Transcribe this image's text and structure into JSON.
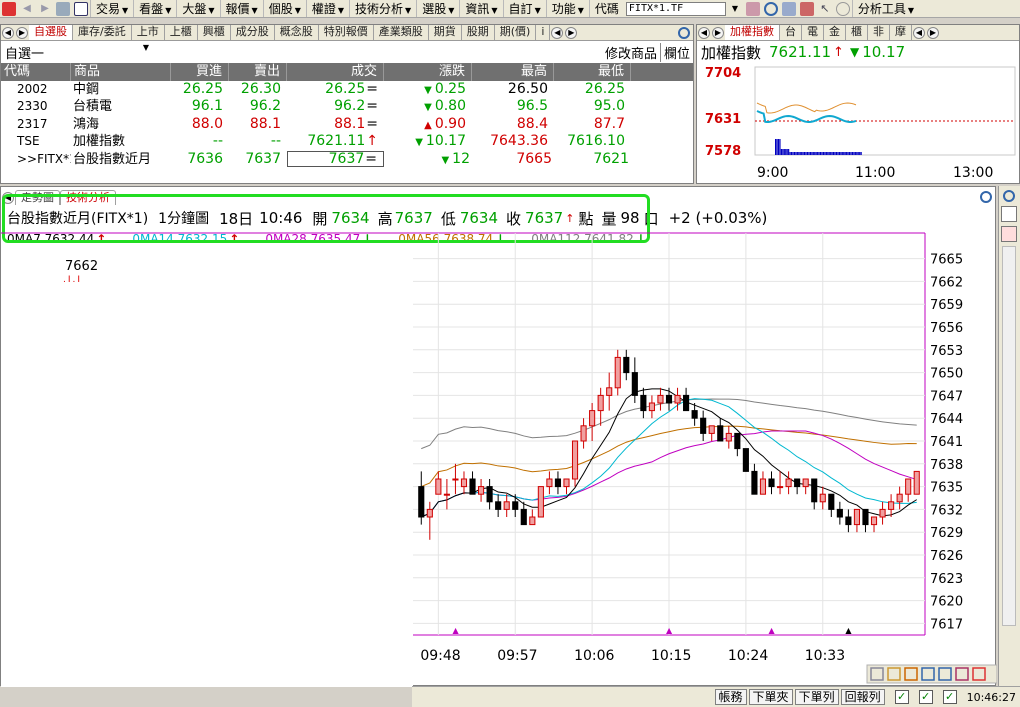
{
  "menubar": {
    "items": [
      "交易",
      "看盤",
      "大盤",
      "報價",
      "個股",
      "權證",
      "技術分析",
      "選股",
      "資訊",
      "自訂",
      "功能"
    ],
    "code_label": "代碼",
    "code_value": "FITX*1.TF",
    "tools_label": "分析工具"
  },
  "watchlist": {
    "tabs": [
      "自選股",
      "庫存/委託",
      "上市",
      "上櫃",
      "興櫃",
      "成分股",
      "概念股",
      "特別報價",
      "產業類股",
      "期貨",
      "股期",
      "期(價)",
      "i"
    ],
    "group": "自選一",
    "modify_label": "修改商品",
    "columns_label": "欄位",
    "headers": [
      "代碼",
      "商品",
      "買進",
      "賣出",
      "成交",
      "漲跌",
      "最高",
      "最低"
    ],
    "rows": [
      {
        "code": "2002",
        "name": "中鋼",
        "bid": "26.25",
        "ask": "26.30",
        "last": "26.25",
        "last_mark": "=",
        "chg_dir": "dn",
        "chg": "0.25",
        "high": "26.50",
        "low": "26.25",
        "color": "g",
        "high_color": "k",
        "low_color": "g"
      },
      {
        "code": "2330",
        "name": "台積電",
        "bid": "96.1",
        "ask": "96.2",
        "last": "96.2",
        "last_mark": "=",
        "chg_dir": "dn",
        "chg": "0.80",
        "high": "96.5",
        "low": "95.0",
        "color": "g",
        "high_color": "g",
        "low_color": "g"
      },
      {
        "code": "2317",
        "name": "鴻海",
        "bid": "88.0",
        "ask": "88.1",
        "last": "88.1",
        "last_mark": "=",
        "chg_dir": "up",
        "chg": "0.90",
        "high": "88.4",
        "low": "87.7",
        "color": "r",
        "high_color": "r",
        "low_color": "r"
      },
      {
        "code": "TSE",
        "name": "加權指數",
        "bid": "--",
        "ask": "--",
        "last": "7621.11",
        "last_mark": "↑",
        "chg_dir": "dn",
        "chg": "10.17",
        "high": "7643.36",
        "low": "7616.10",
        "color": "g",
        "high_color": "r",
        "low_color": "g"
      },
      {
        "code": ">>FITX*1",
        "name": "台股指數近月",
        "bid": "7636",
        "ask": "7637",
        "last": "7637",
        "last_mark": "=",
        "chg_dir": "dn",
        "chg": "12",
        "high": "7665",
        "low": "7621",
        "color": "g",
        "high_color": "r",
        "low_color": "g"
      }
    ]
  },
  "index_panel": {
    "tabs": [
      "加權指數",
      "台",
      "電",
      "金",
      "櫃",
      "非",
      "摩"
    ],
    "title": "加權指數",
    "value": "7621.11",
    "chg": "10.17",
    "y_labels": [
      "7704",
      "7631",
      "7578"
    ],
    "x_labels": [
      "9:00",
      "11:00",
      "13:00"
    ]
  },
  "chart_tabs": [
    "走勢圖",
    "技術分析"
  ],
  "infobar": {
    "name": "台股指數近月(FITX*1)",
    "period": "1分鐘圖",
    "date": "18日",
    "time": "10:46",
    "open_label": "開",
    "open": "7634",
    "high_label": "高",
    "high": "7637",
    "low_label": "低",
    "low": "7634",
    "close_label": "收",
    "close": "7637",
    "unit": "點",
    "volume_label": "量",
    "volume": "98",
    "volume_unit": "口",
    "change": "+2 (+0.03%)"
  },
  "ma_bar": {
    "items": [
      {
        "label": "0MA7 7632.44",
        "dir": "up",
        "color": "#000000"
      },
      {
        "label": "0MA14 7632.15",
        "dir": "up",
        "color": "#00b8d0"
      },
      {
        "label": "0MA28 7635.47",
        "dir": "dn",
        "color": "#c000c0"
      },
      {
        "label": "0MA56 7638.74",
        "dir": "dn",
        "color": "#c07000"
      },
      {
        "label": "0MA112 7641.82",
        "dir": "dn",
        "color": "#808080"
      }
    ]
  },
  "marker_label": "7662",
  "statusbar": {
    "buttons": [
      "帳務",
      "下單夾",
      "下單列",
      "回報列"
    ],
    "time": "10:46:27"
  },
  "colors": {
    "up": "#d00000",
    "down": "#00a000",
    "highlight": "#22dd22",
    "ma7": "#000000",
    "ma14": "#00b8d0",
    "ma28": "#c000c0",
    "ma56": "#c07000",
    "ma112": "#808080"
  },
  "chart_data": {
    "type": "candlestick",
    "y_ticks": [
      7665,
      7662,
      7659,
      7656,
      7653,
      7650,
      7647,
      7644,
      7641,
      7638,
      7635,
      7632,
      7629,
      7626,
      7623,
      7620,
      7617
    ],
    "x_ticks": [
      "09:48",
      "09:57",
      "10:06",
      "10:15",
      "10:24",
      "10:33"
    ],
    "ylim": [
      7616,
      7666
    ],
    "candles": [
      [
        7635,
        7637,
        7630,
        7631
      ],
      [
        7631,
        7633,
        7628,
        7632
      ],
      [
        7634,
        7637,
        7634,
        7636
      ],
      [
        7634,
        7636,
        7632,
        7634
      ],
      [
        7636,
        7638,
        7634,
        7636
      ],
      [
        7635,
        7637,
        7634,
        7636
      ],
      [
        7636,
        7637,
        7634,
        7634
      ],
      [
        7634,
        7636,
        7633,
        7635
      ],
      [
        7635,
        7636,
        7632,
        7633
      ],
      [
        7633,
        7634,
        7631,
        7632
      ],
      [
        7632,
        7634,
        7631,
        7633
      ],
      [
        7633,
        7634,
        7631,
        7632
      ],
      [
        7632,
        7633,
        7630,
        7630
      ],
      [
        7630,
        7632,
        7630,
        7631
      ],
      [
        7631,
        7635,
        7631,
        7635
      ],
      [
        7635,
        7637,
        7634,
        7636
      ],
      [
        7636,
        7637,
        7634,
        7635
      ],
      [
        7635,
        7636,
        7634,
        7636
      ],
      [
        7636,
        7641,
        7635,
        7641
      ],
      [
        7641,
        7644,
        7640,
        7643
      ],
      [
        7643,
        7646,
        7641,
        7645
      ],
      [
        7645,
        7648,
        7643,
        7647
      ],
      [
        7647,
        7650,
        7645,
        7648
      ],
      [
        7648,
        7653,
        7647,
        7652
      ],
      [
        7652,
        7653,
        7649,
        7650
      ],
      [
        7650,
        7652,
        7646,
        7647
      ],
      [
        7647,
        7648,
        7644,
        7645
      ],
      [
        7645,
        7647,
        7644,
        7646
      ],
      [
        7646,
        7648,
        7645,
        7647
      ],
      [
        7647,
        7648,
        7645,
        7646
      ],
      [
        7646,
        7648,
        7645,
        7647
      ],
      [
        7647,
        7648,
        7645,
        7645
      ],
      [
        7645,
        7646,
        7643,
        7644
      ],
      [
        7644,
        7645,
        7641,
        7642
      ],
      [
        7642,
        7643,
        7641,
        7643
      ],
      [
        7643,
        7644,
        7641,
        7641
      ],
      [
        7641,
        7643,
        7640,
        7642
      ],
      [
        7642,
        7642,
        7639,
        7640
      ],
      [
        7640,
        7640,
        7637,
        7637
      ],
      [
        7637,
        7638,
        7634,
        7634
      ],
      [
        7634,
        7637,
        7634,
        7636
      ],
      [
        7636,
        7637,
        7634,
        7635
      ],
      [
        7635,
        7637,
        7634,
        7635
      ],
      [
        7635,
        7637,
        7634,
        7636
      ],
      [
        7636,
        7636,
        7634,
        7635
      ],
      [
        7635,
        7636,
        7634,
        7636
      ],
      [
        7636,
        7636,
        7632,
        7633
      ],
      [
        7633,
        7635,
        7632,
        7634
      ],
      [
        7634,
        7634,
        7631,
        7632
      ],
      [
        7632,
        7633,
        7630,
        7631
      ],
      [
        7631,
        7632,
        7629,
        7630
      ],
      [
        7630,
        7632,
        7629,
        7632
      ],
      [
        7632,
        7632,
        7629,
        7630
      ],
      [
        7630,
        7631,
        7629,
        7631
      ],
      [
        7631,
        7633,
        7630,
        7632
      ],
      [
        7632,
        7634,
        7631,
        7633
      ],
      [
        7633,
        7635,
        7632,
        7634
      ],
      [
        7634,
        7636,
        7633,
        7636
      ],
      [
        7634,
        7637,
        7634,
        7637
      ]
    ],
    "candle_fields": [
      "open",
      "high",
      "low",
      "close"
    ]
  }
}
